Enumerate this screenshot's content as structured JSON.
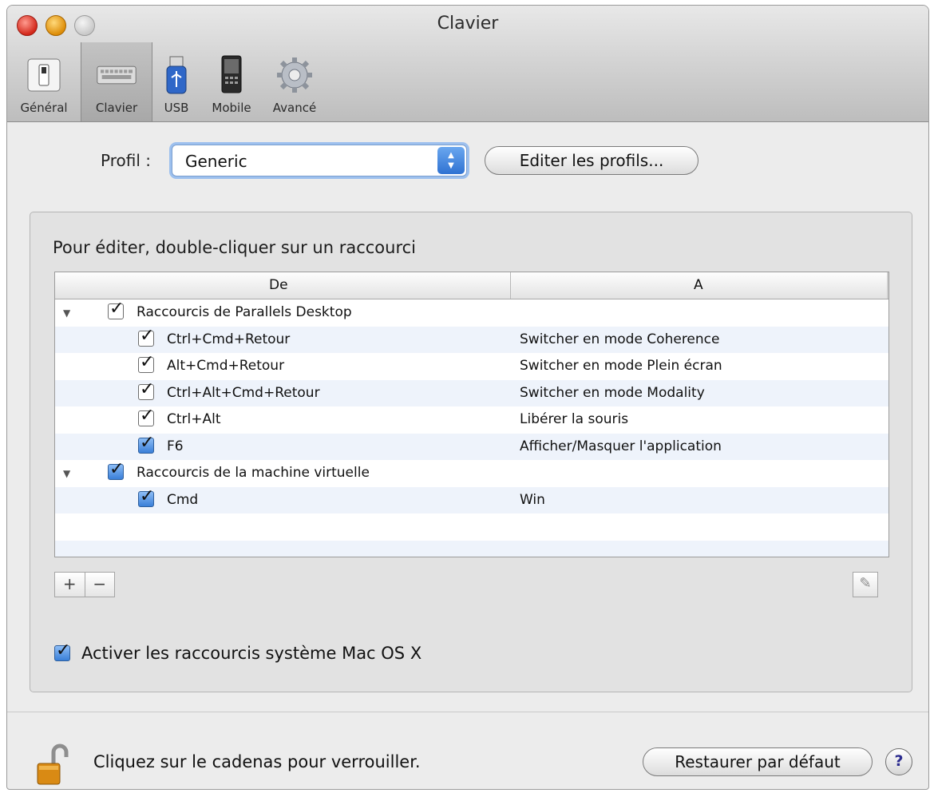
{
  "window": {
    "title": "Clavier"
  },
  "toolbar": {
    "items": [
      {
        "label": "Général",
        "icon": "general-switch-icon"
      },
      {
        "label": "Clavier",
        "icon": "keyboard-icon"
      },
      {
        "label": "USB",
        "icon": "usb-icon"
      },
      {
        "label": "Mobile",
        "icon": "mobile-icon"
      },
      {
        "label": "Avancé",
        "icon": "gear-icon"
      }
    ],
    "selected": "Clavier"
  },
  "profile": {
    "label": "Profil :",
    "value": "Generic",
    "edit_button": "Editer les profils..."
  },
  "shortcuts": {
    "instructions": "Pour éditer, double-cliquer sur un raccourci",
    "columns": {
      "from": "De",
      "to": "A"
    },
    "groups": [
      {
        "name": "Raccourcis de Parallels Desktop",
        "checked": true,
        "items": [
          {
            "from": "Ctrl+Cmd+Retour",
            "to": "Switcher en mode Coherence",
            "checked": true
          },
          {
            "from": "Alt+Cmd+Retour",
            "to": "Switcher en mode Plein écran",
            "checked": true
          },
          {
            "from": "Ctrl+Alt+Cmd+Retour",
            "to": "Switcher en mode Modality",
            "checked": true
          },
          {
            "from": "Ctrl+Alt",
            "to": "Libérer la souris",
            "checked": true
          },
          {
            "from": "F6",
            "to": "Afficher/Masquer l'application",
            "checked": true
          }
        ]
      },
      {
        "name": "Raccourcis de la machine virtuelle",
        "checked": true,
        "items": [
          {
            "from": "Cmd",
            "to": "Win",
            "checked": true
          }
        ]
      }
    ],
    "add_label": "+",
    "remove_label": "−",
    "edit_icon": "pencil-icon"
  },
  "system_shortcuts": {
    "label": "Activer les raccourcis système Mac OS X",
    "checked": true
  },
  "footer": {
    "lock_text": "Cliquez sur le cadenas pour verrouiller.",
    "restore_button": "Restaurer par défaut",
    "help_label": "?"
  },
  "colors": {
    "accent": "#3a7fd8",
    "row_alt": "#eef3fb",
    "lock": "#d98a14"
  }
}
